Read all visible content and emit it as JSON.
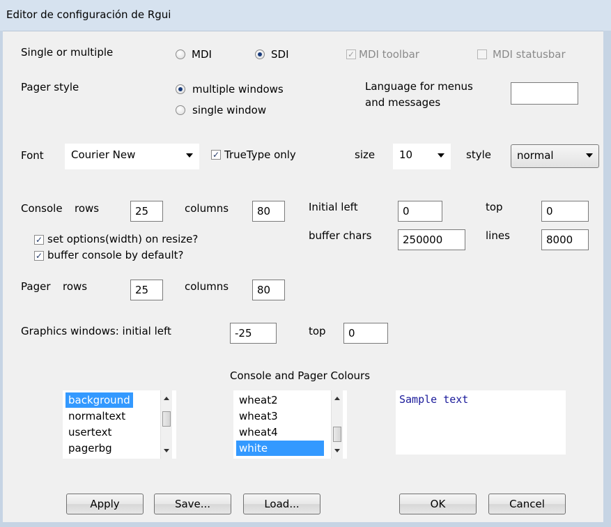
{
  "window": {
    "title": "Editor de configuración de Rgui"
  },
  "mode": {
    "label": "Single or multiple",
    "mdi_label": "MDI",
    "sdi_label": "SDI",
    "selected": "SDI",
    "mdi_toolbar_label": "MDI toolbar",
    "mdi_toolbar_checked": true,
    "mdi_statusbar_label": "MDI statusbar",
    "mdi_statusbar_checked": false
  },
  "pager_style": {
    "label": "Pager style",
    "multiple_label": "multiple windows",
    "single_label": "single window",
    "selected": "multiple windows"
  },
  "language": {
    "label_line1": "Language for menus",
    "label_line2": "and messages",
    "value": ""
  },
  "font": {
    "label": "Font",
    "value": "Courier New",
    "truetype_label": "TrueType only",
    "truetype_checked": true,
    "size_label": "size",
    "size_value": "10",
    "style_label": "style",
    "style_value": "normal"
  },
  "console": {
    "label": "Console",
    "rows_label": "rows",
    "rows_value": "25",
    "columns_label": "columns",
    "columns_value": "80",
    "initial_left_label": "Initial left",
    "initial_left_value": "0",
    "top_label": "top",
    "top_value": "0",
    "buffer_chars_label": "buffer chars",
    "buffer_chars_value": "250000",
    "lines_label": "lines",
    "lines_value": "8000",
    "set_options_label": "set options(width) on resize?",
    "set_options_checked": true,
    "buffer_default_label": "buffer console by default?",
    "buffer_default_checked": true
  },
  "pager": {
    "label": "Pager",
    "rows_label": "rows",
    "rows_value": "25",
    "columns_label": "columns",
    "columns_value": "80"
  },
  "graphics": {
    "label": "Graphics windows: initial left",
    "left_value": "-25",
    "top_label": "top",
    "top_value": "0"
  },
  "colours": {
    "heading": "Console and Pager Colours",
    "elements": [
      "background",
      "normaltext",
      "usertext",
      "pagerbg"
    ],
    "selected_element": "background",
    "colour_names": [
      "wheat2",
      "wheat3",
      "wheat4",
      "white"
    ],
    "selected_colour": "white",
    "sample_text": "Sample text",
    "sample_color": "#1a1a9a",
    "selection_color": "#3399ff"
  },
  "buttons": {
    "apply": "Apply",
    "save": "Save...",
    "load": "Load...",
    "ok": "OK",
    "cancel": "Cancel"
  }
}
